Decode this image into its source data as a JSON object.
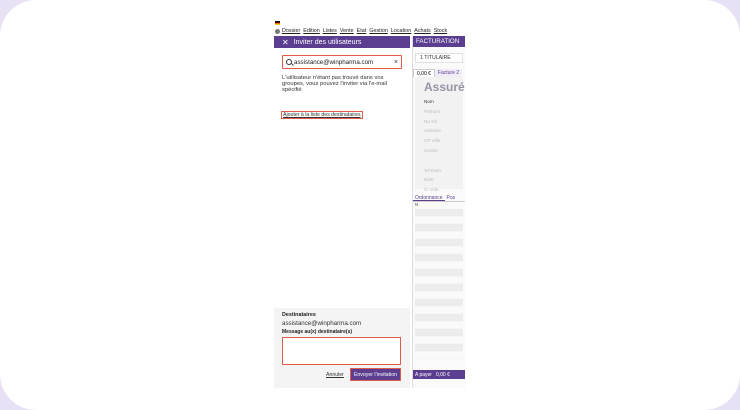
{
  "menu": [
    "Dossier",
    "Edition",
    "Listes",
    "Vente",
    "Etat",
    "Gestion",
    "Location",
    "Achats",
    "Stock"
  ],
  "dialog": {
    "title": "Inviter des utilisateurs",
    "search_value": "assistance@winpharma.com",
    "not_found_message": "L'utilisateur n'étant pas trouvé dans vos groupes, vous pouvez l'inviter via l'e-mail spécifié",
    "add_link": "Ajouter à la liste des destinataires",
    "recipients_title": "Destinataires",
    "recipient_email": "assistance@winpharma.com",
    "message_label": "Message au(x) destinataire(s)",
    "message_value": "",
    "cancel_label": "Annuler",
    "send_label": "Envoyer l'invitation"
  },
  "billing": {
    "header": "FACTURATION",
    "titulaire": "1 TITULAIRE",
    "tab_amount": "0,00 €",
    "tab_invoice": "Facture 2",
    "assure_title": "Assuré",
    "fields": [
      "Nom",
      "Prénom",
      "No SS",
      "Adresse",
      "CP Ville",
      "Centre",
      "",
      "Tel Dom",
      "Note",
      "O. vide"
    ],
    "tab_ordonnance": "Ordonnance",
    "tab_pos": "Pos",
    "col_n": "N",
    "pay_label": "A payer",
    "pay_amount": "0,00 €"
  },
  "colors": {
    "accent": "#5b3e8f",
    "highlight": "#e25a4a",
    "frame_bg": "#e8e1f6"
  }
}
